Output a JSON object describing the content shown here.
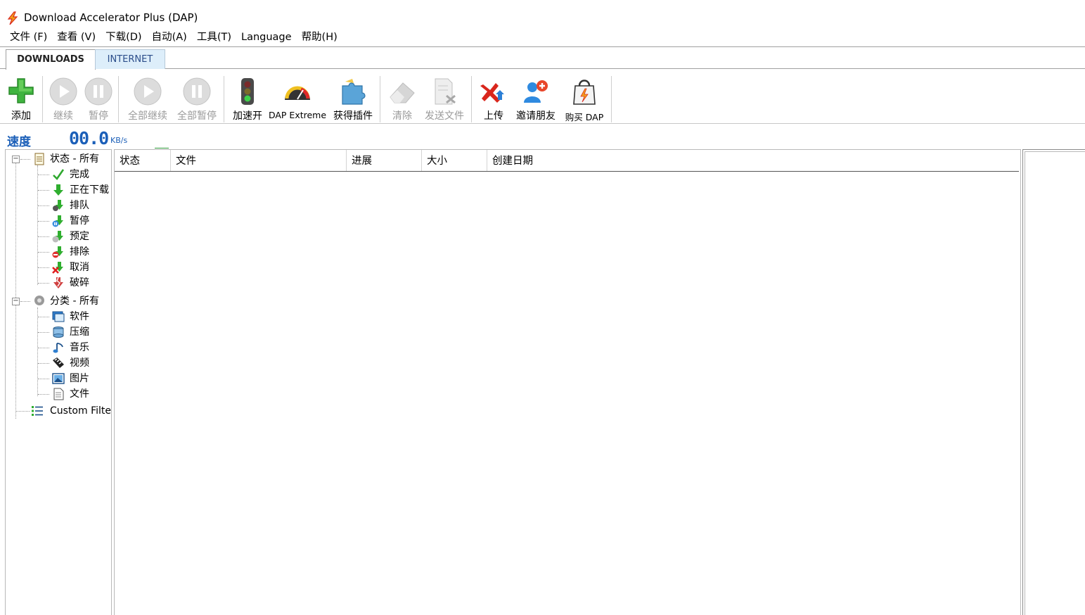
{
  "window": {
    "title": "Download Accelerator Plus (DAP)"
  },
  "menu": [
    {
      "label": "文件 (F)"
    },
    {
      "label": "查看 (V)"
    },
    {
      "label": "下载(D)"
    },
    {
      "label": "自动(A)"
    },
    {
      "label": "工具(T)"
    },
    {
      "label": "Language"
    },
    {
      "label": "帮助(H)"
    }
  ],
  "tabs": [
    {
      "label": "DOWNLOADS",
      "active": true
    },
    {
      "label": "INTERNET",
      "active": false
    }
  ],
  "toolbar": {
    "add": "添加",
    "resume": "继续",
    "pause": "暂停",
    "resume_all": "全部继续",
    "pause_all": "全部暂停",
    "accelerate": "加速开",
    "dap_extreme": "DAP Extreme",
    "get_plugins": "获得插件",
    "clear": "清除",
    "send_file": "发送文件",
    "upload": "上传",
    "invite_friends": "邀请朋友",
    "buy_dap": "购买 DAP"
  },
  "speed": {
    "label": "速度",
    "value": "00.0",
    "unit": "KB/s"
  },
  "tree": {
    "status_root": "状态 - 所有",
    "status_items": [
      {
        "label": "完成",
        "icon": "check-icon"
      },
      {
        "label": "正在下载",
        "icon": "download-arrow-icon"
      },
      {
        "label": "排队",
        "icon": "queue-icon"
      },
      {
        "label": "暂停",
        "icon": "paused-icon"
      },
      {
        "label": "预定",
        "icon": "scheduled-icon"
      },
      {
        "label": "排除",
        "icon": "excluded-icon"
      },
      {
        "label": "取消",
        "icon": "cancelled-icon"
      },
      {
        "label": "破碎",
        "icon": "broken-icon"
      }
    ],
    "category_root": "分类 - 所有",
    "category_items": [
      {
        "label": "软件",
        "icon": "software-icon"
      },
      {
        "label": "压缩",
        "icon": "archive-icon"
      },
      {
        "label": "音乐",
        "icon": "music-icon"
      },
      {
        "label": "视频",
        "icon": "video-icon"
      },
      {
        "label": "图片",
        "icon": "picture-icon"
      },
      {
        "label": "文件",
        "icon": "document-icon"
      }
    ],
    "custom_filter": "Custom Filter"
  },
  "list": {
    "columns": [
      "状态",
      "文件",
      "进展",
      "大小",
      "创建日期"
    ],
    "rows": []
  },
  "colors": {
    "speed": "#1b5fb8",
    "add_green": "#3fb43f",
    "upload_red": "#d9261c"
  }
}
